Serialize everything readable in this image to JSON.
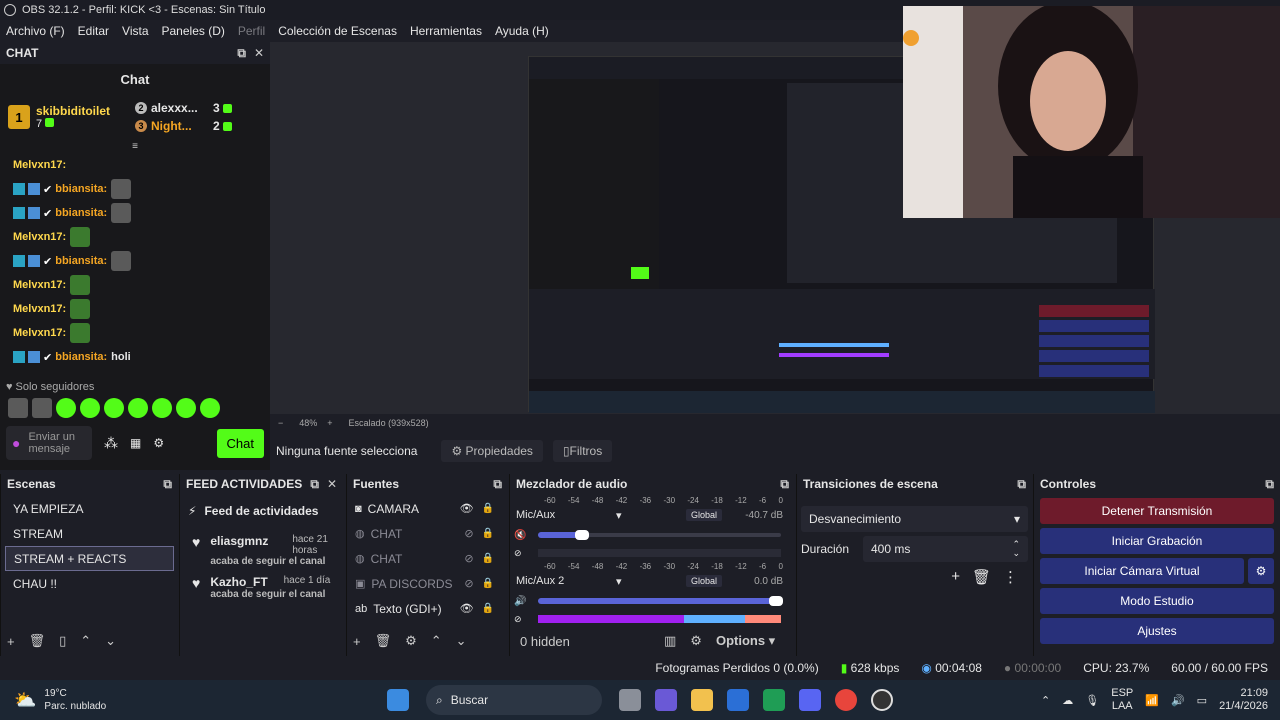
{
  "window": {
    "title": "OBS 32.1.2 - Perfil: KICK <3 - Escenas: Sin Título"
  },
  "menu": [
    "Archivo (F)",
    "Editar",
    "Vista",
    "Paneles (D)",
    "Perfil",
    "Colección de Escenas",
    "Herramientas",
    "Ayuda (H)"
  ],
  "chat": {
    "dock_title": "CHAT",
    "panel_title": "Chat",
    "leaders": {
      "first": {
        "name": "skibbiditoilet",
        "count": "7",
        "rank": "1"
      },
      "second": {
        "name": "alexxx...",
        "count": "3",
        "rank": "2"
      },
      "third": {
        "name": "Night...",
        "count": "2",
        "rank": "3"
      }
    },
    "lines": [
      {
        "user": "Melvxn17:",
        "text": "",
        "badges": false,
        "color": "yellow",
        "emotes": 0
      },
      {
        "user": "bbiansita:",
        "text": "",
        "badges": true,
        "color": "orange",
        "emotes": 1
      },
      {
        "user": "bbiansita:",
        "text": "",
        "badges": true,
        "color": "orange",
        "emotes": 1
      },
      {
        "user": "Melvxn17:",
        "text": "",
        "badges": false,
        "color": "yellow",
        "emotes": 1
      },
      {
        "user": "bbiansita:",
        "text": "",
        "badges": true,
        "color": "orange",
        "emotes": 1
      },
      {
        "user": "Melvxn17:",
        "text": "",
        "badges": false,
        "color": "yellow",
        "emotes": 1
      },
      {
        "user": "Melvxn17:",
        "text": "",
        "badges": false,
        "color": "yellow",
        "emotes": 1
      },
      {
        "user": "Melvxn17:",
        "text": "",
        "badges": false,
        "color": "yellow",
        "emotes": 1
      },
      {
        "user": "bbiansita:",
        "text": "holi",
        "badges": true,
        "color": "orange",
        "emotes": 0
      }
    ],
    "followers_only": "Solo seguidores",
    "input_placeholder": "Enviar un mensaje",
    "chat_button": "Chat"
  },
  "preview": {
    "zoom": "48%",
    "scale": "Escalado (939x528)",
    "no_source": "Ninguna fuente selecciona",
    "properties": "Propiedades",
    "filters": "Filtros"
  },
  "scenes": {
    "title": "Escenas",
    "items": [
      "YA EMPIEZA",
      "STREAM",
      "STREAM + REACTS",
      "CHAU !!"
    ],
    "selected_index": 2
  },
  "feed": {
    "title": "FEED ACTIVIDADES",
    "header": "Feed de actividades",
    "items": [
      {
        "user": "eliasgmnz",
        "time": "hace 21 horas",
        "text": "acaba de seguir el canal"
      },
      {
        "user": "Kazho_FT",
        "time": "hace 1 día",
        "text": "acaba de seguir el canal"
      }
    ]
  },
  "sources": {
    "title": "Fuentes",
    "items": [
      {
        "name": "CAMARA",
        "visible": true,
        "icon": "camera-icon"
      },
      {
        "name": "CHAT",
        "visible": false,
        "icon": "globe-icon"
      },
      {
        "name": "CHAT",
        "visible": false,
        "icon": "globe-icon"
      },
      {
        "name": "PA DISCORDS",
        "visible": false,
        "icon": "window-icon"
      },
      {
        "name": "Texto (GDI+)",
        "visible": true,
        "icon": "text-icon"
      }
    ]
  },
  "mixer": {
    "title": "Mezclador de audio",
    "scale": [
      "-60",
      "-54",
      "-48",
      "-42",
      "-36",
      "-30",
      "-24",
      "-18",
      "-12",
      "-6",
      "0"
    ],
    "channels": [
      {
        "name": "Mic/Aux",
        "tag": "Global",
        "db": "-40.7 dB",
        "level": 0.18,
        "muted": true
      },
      {
        "name": "Mic/Aux 2",
        "tag": "Global",
        "db": "0.0 dB",
        "level": 0.98,
        "muted": false
      }
    ],
    "hidden": "0 hidden",
    "options": "Options"
  },
  "transitions": {
    "title": "Transiciones de escena",
    "selected": "Desvanecimiento",
    "duration_label": "Duración",
    "duration_value": "400 ms"
  },
  "controls": {
    "title": "Controles",
    "buttons": [
      "Detener Transmisión",
      "Iniciar Grabación",
      "Iniciar Cámara Virtual",
      "Modo Estudio",
      "Ajustes"
    ]
  },
  "status": {
    "dropped": "Fotogramas Perdidos 0 (0.0%)",
    "bitrate": "628 kbps",
    "stream_time": "00:04:08",
    "rec_time": "00:00:00",
    "cpu": "CPU: 23.7%",
    "fps": "60.00 / 60.00 FPS"
  },
  "taskbar": {
    "weather_temp": "19°C",
    "weather_desc": "Parc. nublado",
    "search": "Buscar",
    "lang1": "ESP",
    "lang2": "LAA",
    "time": "21:09",
    "date": "21/4/2026"
  },
  "colors": {
    "kick_green": "#53fc18",
    "control_blue": "#28307a",
    "stop_red": "#6e1b2b"
  }
}
